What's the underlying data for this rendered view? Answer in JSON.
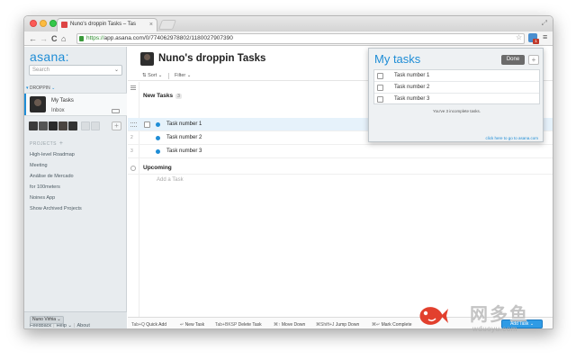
{
  "browser": {
    "tab_title": "Nuno's droppin Tasks – Tas",
    "tab_close": "×",
    "url_scheme": "https://",
    "url_rest": "app.asana.com/0/774062978802/1180027907390",
    "ext_badge": "1",
    "nav_back": "←",
    "nav_forward": "→",
    "nav_reload": "C",
    "nav_home": "⌂",
    "star": "☆",
    "menu": "≡",
    "resize": "⤢"
  },
  "sidebar": {
    "logo": "asana",
    "search_placeholder": "Search",
    "workspace_label": "DROPPIN",
    "my_tasks": "My Tasks",
    "inbox": "Inbox",
    "projects_header": "PROJECTS",
    "projects": [
      "High-level Roadmap",
      "Meeting",
      "Análise de Mercado",
      "for 100meters",
      "Noines App",
      "Show Archived Projects"
    ],
    "user_menu": "Nuno Virhia",
    "footer": {
      "feedback": "Feedback",
      "help": "Help",
      "about": "About"
    }
  },
  "main": {
    "title": "Nuno's droppin Tasks",
    "sort_label": "Sort",
    "filter_label": "Filter",
    "section_new": "New Tasks",
    "section_new_count": "3",
    "tasks": [
      {
        "num": "",
        "name": "Task number 1"
      },
      {
        "num": "2",
        "name": "Task number 2"
      },
      {
        "num": "3",
        "name": "Task number 3"
      }
    ],
    "section_upcoming": "Upcoming",
    "add_task_placeholder": "Add a Task"
  },
  "shortcuts": [
    {
      "key": "Tab+Q",
      "label": "Quick Add"
    },
    {
      "key": "↵",
      "label": "New Task"
    },
    {
      "key": "Tab+BKSP",
      "label": "Delete Task"
    },
    {
      "key": "⌘↑",
      "label": "Move Down"
    },
    {
      "key": "⌘Shift+J",
      "label": "Jump Down"
    },
    {
      "key": "⌘↵",
      "label": "Mark Complete"
    }
  ],
  "add_task_button": "Add Task",
  "popup": {
    "title": "My tasks",
    "done_label": "Done",
    "add_label": "+",
    "tasks": [
      "Task number 1",
      "Task number 2",
      "Task number 3"
    ],
    "incomplete_note": "You've 3 incomplete tasks.",
    "link": "click here to go to asana.com"
  },
  "watermark": {
    "text": "网多鱼",
    "sub": "wduoyu.com"
  },
  "colors": {
    "accent": "#1f8dd6",
    "sidebar_bg": "#e8ecef",
    "selected_row": "#e6f2fb",
    "done_button": "#6b6b6b"
  }
}
